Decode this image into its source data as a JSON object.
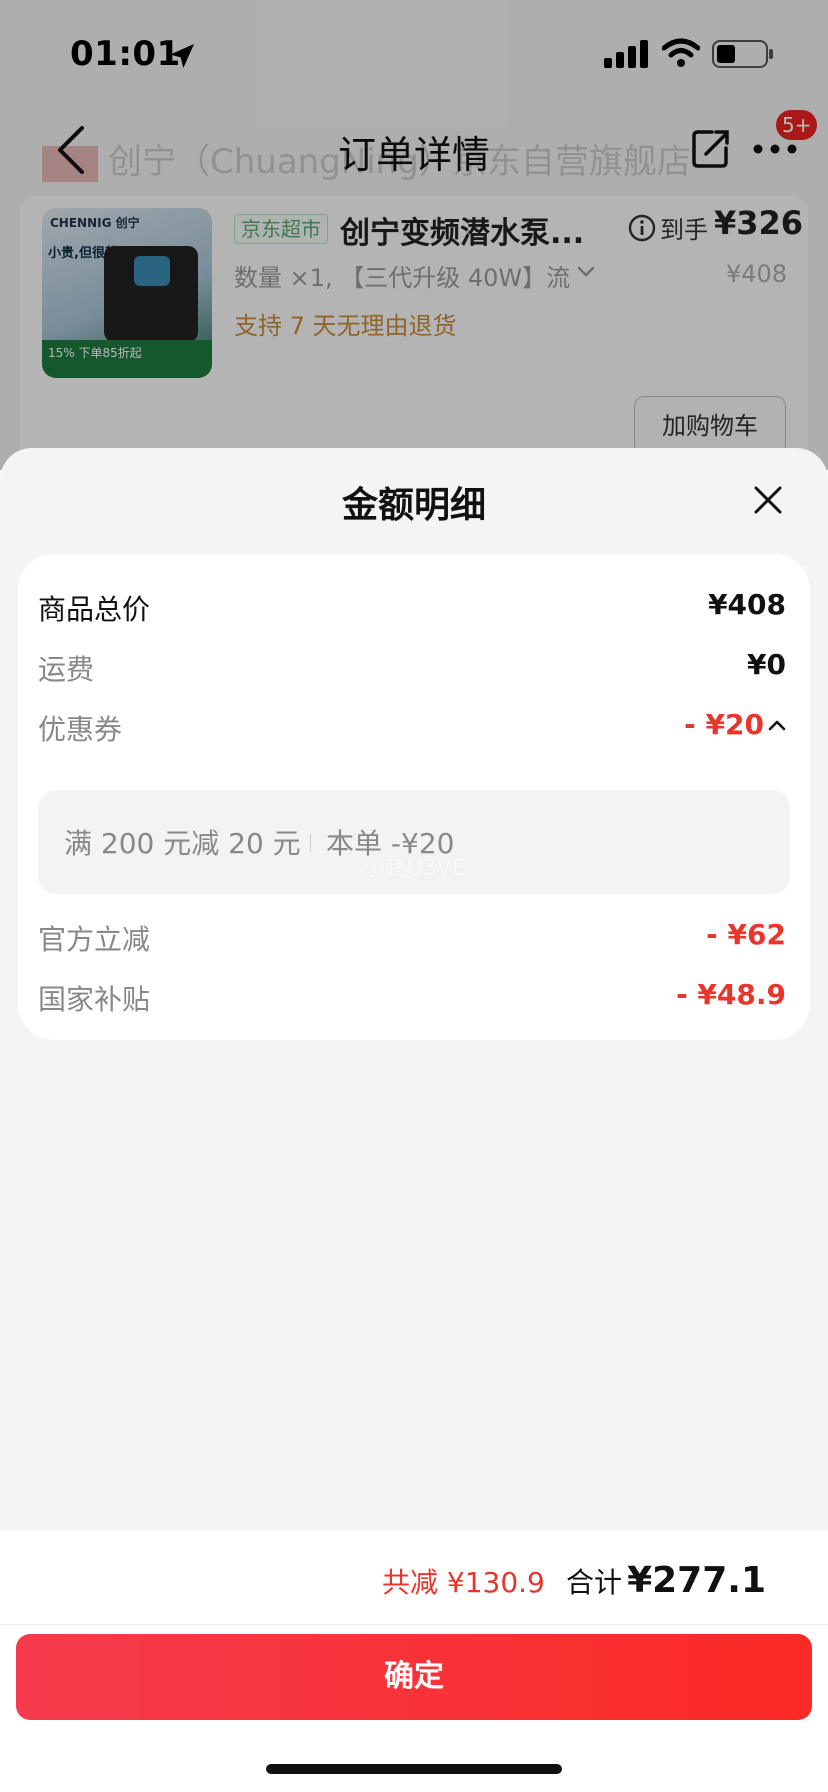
{
  "status_bar": {
    "time": "01:01",
    "icons": [
      "location-arrow-icon",
      "signal-icon",
      "wifi-icon",
      "battery-icon"
    ]
  },
  "nav": {
    "title": "订单详情",
    "shop_name_ghost": "创宁（ChuangNing）京东自营旗舰店",
    "badge": "5+",
    "icons": [
      "back-icon",
      "share-icon",
      "more-icon"
    ]
  },
  "product": {
    "store_tag": "京东超市",
    "title": "创宁变频潜水泵...",
    "arrive_label": "到手",
    "arrive_price": "¥326",
    "spec": "数量 ×1, 【三代升级 40W】流",
    "original_price": "¥408",
    "return_note": "支持 7 天无理由退货",
    "add_to_cart": "加购物车",
    "thumb": {
      "brand": "CHENNIG 创宁",
      "slogan": "小贵,但很静",
      "promo": "15% 下单85折起"
    }
  },
  "sheet": {
    "title": "金额明细",
    "rows": [
      {
        "label": "商品总价",
        "value": "¥408"
      },
      {
        "label": "运费",
        "value": "¥0"
      },
      {
        "label": "优惠券",
        "value": "- ¥20"
      },
      {
        "label": "官方立减",
        "value": "- ¥62"
      },
      {
        "label": "国家补贴",
        "value": "- ¥48.9"
      }
    ],
    "coupon_detail": {
      "rule": "满 200 元减 20 元",
      "this_order": "本单 -¥20"
    },
    "watermark": "小赵U3VE"
  },
  "footer": {
    "total_off": "共减 ¥130.9",
    "total_label": "合计",
    "total_value": "¥277.1",
    "confirm": "确定"
  },
  "colors": {
    "accent_red": "#e8362d",
    "button_gradient_start": "#f53b4d",
    "button_gradient_end": "#fb2a24"
  }
}
